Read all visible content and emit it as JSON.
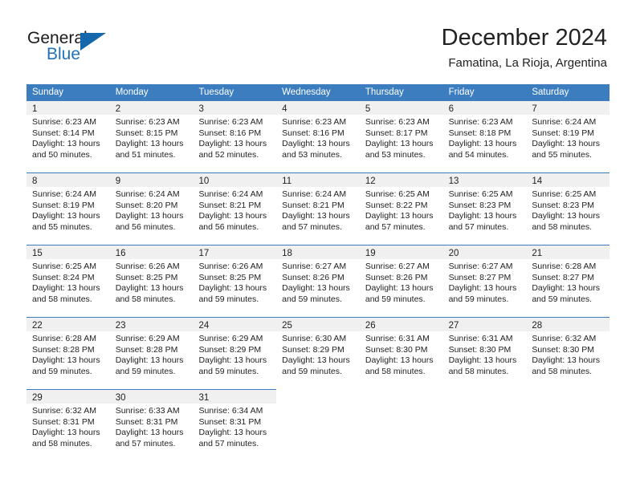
{
  "brand": {
    "name_part1": "General",
    "name_part2": "Blue",
    "accent_color": "#1567ab",
    "text_color": "#1a1a1a"
  },
  "header": {
    "title": "December 2024",
    "location": "Famatina, La Rioja, Argentina"
  },
  "calendar": {
    "header_bg": "#3c7dbf",
    "header_text_color": "#ffffff",
    "daynum_band_bg": "#f0f0f0",
    "weekdays": [
      "Sunday",
      "Monday",
      "Tuesday",
      "Wednesday",
      "Thursday",
      "Friday",
      "Saturday"
    ],
    "weeks": [
      [
        {
          "day": "1",
          "sunrise": "Sunrise: 6:23 AM",
          "sunset": "Sunset: 8:14 PM",
          "daylight_line1": "Daylight: 13 hours",
          "daylight_line2": "and 50 minutes."
        },
        {
          "day": "2",
          "sunrise": "Sunrise: 6:23 AM",
          "sunset": "Sunset: 8:15 PM",
          "daylight_line1": "Daylight: 13 hours",
          "daylight_line2": "and 51 minutes."
        },
        {
          "day": "3",
          "sunrise": "Sunrise: 6:23 AM",
          "sunset": "Sunset: 8:16 PM",
          "daylight_line1": "Daylight: 13 hours",
          "daylight_line2": "and 52 minutes."
        },
        {
          "day": "4",
          "sunrise": "Sunrise: 6:23 AM",
          "sunset": "Sunset: 8:16 PM",
          "daylight_line1": "Daylight: 13 hours",
          "daylight_line2": "and 53 minutes."
        },
        {
          "day": "5",
          "sunrise": "Sunrise: 6:23 AM",
          "sunset": "Sunset: 8:17 PM",
          "daylight_line1": "Daylight: 13 hours",
          "daylight_line2": "and 53 minutes."
        },
        {
          "day": "6",
          "sunrise": "Sunrise: 6:23 AM",
          "sunset": "Sunset: 8:18 PM",
          "daylight_line1": "Daylight: 13 hours",
          "daylight_line2": "and 54 minutes."
        },
        {
          "day": "7",
          "sunrise": "Sunrise: 6:24 AM",
          "sunset": "Sunset: 8:19 PM",
          "daylight_line1": "Daylight: 13 hours",
          "daylight_line2": "and 55 minutes."
        }
      ],
      [
        {
          "day": "8",
          "sunrise": "Sunrise: 6:24 AM",
          "sunset": "Sunset: 8:19 PM",
          "daylight_line1": "Daylight: 13 hours",
          "daylight_line2": "and 55 minutes."
        },
        {
          "day": "9",
          "sunrise": "Sunrise: 6:24 AM",
          "sunset": "Sunset: 8:20 PM",
          "daylight_line1": "Daylight: 13 hours",
          "daylight_line2": "and 56 minutes."
        },
        {
          "day": "10",
          "sunrise": "Sunrise: 6:24 AM",
          "sunset": "Sunset: 8:21 PM",
          "daylight_line1": "Daylight: 13 hours",
          "daylight_line2": "and 56 minutes."
        },
        {
          "day": "11",
          "sunrise": "Sunrise: 6:24 AM",
          "sunset": "Sunset: 8:21 PM",
          "daylight_line1": "Daylight: 13 hours",
          "daylight_line2": "and 57 minutes."
        },
        {
          "day": "12",
          "sunrise": "Sunrise: 6:25 AM",
          "sunset": "Sunset: 8:22 PM",
          "daylight_line1": "Daylight: 13 hours",
          "daylight_line2": "and 57 minutes."
        },
        {
          "day": "13",
          "sunrise": "Sunrise: 6:25 AM",
          "sunset": "Sunset: 8:23 PM",
          "daylight_line1": "Daylight: 13 hours",
          "daylight_line2": "and 57 minutes."
        },
        {
          "day": "14",
          "sunrise": "Sunrise: 6:25 AM",
          "sunset": "Sunset: 8:23 PM",
          "daylight_line1": "Daylight: 13 hours",
          "daylight_line2": "and 58 minutes."
        }
      ],
      [
        {
          "day": "15",
          "sunrise": "Sunrise: 6:25 AM",
          "sunset": "Sunset: 8:24 PM",
          "daylight_line1": "Daylight: 13 hours",
          "daylight_line2": "and 58 minutes."
        },
        {
          "day": "16",
          "sunrise": "Sunrise: 6:26 AM",
          "sunset": "Sunset: 8:25 PM",
          "daylight_line1": "Daylight: 13 hours",
          "daylight_line2": "and 58 minutes."
        },
        {
          "day": "17",
          "sunrise": "Sunrise: 6:26 AM",
          "sunset": "Sunset: 8:25 PM",
          "daylight_line1": "Daylight: 13 hours",
          "daylight_line2": "and 59 minutes."
        },
        {
          "day": "18",
          "sunrise": "Sunrise: 6:27 AM",
          "sunset": "Sunset: 8:26 PM",
          "daylight_line1": "Daylight: 13 hours",
          "daylight_line2": "and 59 minutes."
        },
        {
          "day": "19",
          "sunrise": "Sunrise: 6:27 AM",
          "sunset": "Sunset: 8:26 PM",
          "daylight_line1": "Daylight: 13 hours",
          "daylight_line2": "and 59 minutes."
        },
        {
          "day": "20",
          "sunrise": "Sunrise: 6:27 AM",
          "sunset": "Sunset: 8:27 PM",
          "daylight_line1": "Daylight: 13 hours",
          "daylight_line2": "and 59 minutes."
        },
        {
          "day": "21",
          "sunrise": "Sunrise: 6:28 AM",
          "sunset": "Sunset: 8:27 PM",
          "daylight_line1": "Daylight: 13 hours",
          "daylight_line2": "and 59 minutes."
        }
      ],
      [
        {
          "day": "22",
          "sunrise": "Sunrise: 6:28 AM",
          "sunset": "Sunset: 8:28 PM",
          "daylight_line1": "Daylight: 13 hours",
          "daylight_line2": "and 59 minutes."
        },
        {
          "day": "23",
          "sunrise": "Sunrise: 6:29 AM",
          "sunset": "Sunset: 8:28 PM",
          "daylight_line1": "Daylight: 13 hours",
          "daylight_line2": "and 59 minutes."
        },
        {
          "day": "24",
          "sunrise": "Sunrise: 6:29 AM",
          "sunset": "Sunset: 8:29 PM",
          "daylight_line1": "Daylight: 13 hours",
          "daylight_line2": "and 59 minutes."
        },
        {
          "day": "25",
          "sunrise": "Sunrise: 6:30 AM",
          "sunset": "Sunset: 8:29 PM",
          "daylight_line1": "Daylight: 13 hours",
          "daylight_line2": "and 59 minutes."
        },
        {
          "day": "26",
          "sunrise": "Sunrise: 6:31 AM",
          "sunset": "Sunset: 8:30 PM",
          "daylight_line1": "Daylight: 13 hours",
          "daylight_line2": "and 58 minutes."
        },
        {
          "day": "27",
          "sunrise": "Sunrise: 6:31 AM",
          "sunset": "Sunset: 8:30 PM",
          "daylight_line1": "Daylight: 13 hours",
          "daylight_line2": "and 58 minutes."
        },
        {
          "day": "28",
          "sunrise": "Sunrise: 6:32 AM",
          "sunset": "Sunset: 8:30 PM",
          "daylight_line1": "Daylight: 13 hours",
          "daylight_line2": "and 58 minutes."
        }
      ],
      [
        {
          "day": "29",
          "sunrise": "Sunrise: 6:32 AM",
          "sunset": "Sunset: 8:31 PM",
          "daylight_line1": "Daylight: 13 hours",
          "daylight_line2": "and 58 minutes."
        },
        {
          "day": "30",
          "sunrise": "Sunrise: 6:33 AM",
          "sunset": "Sunset: 8:31 PM",
          "daylight_line1": "Daylight: 13 hours",
          "daylight_line2": "and 57 minutes."
        },
        {
          "day": "31",
          "sunrise": "Sunrise: 6:34 AM",
          "sunset": "Sunset: 8:31 PM",
          "daylight_line1": "Daylight: 13 hours",
          "daylight_line2": "and 57 minutes."
        },
        null,
        null,
        null,
        null
      ]
    ]
  }
}
